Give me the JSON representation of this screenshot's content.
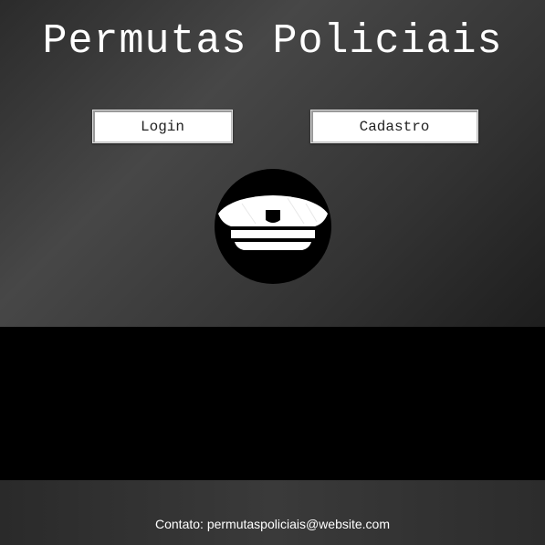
{
  "header": {
    "title": "Permutas Policiais"
  },
  "nav": {
    "login_label": "Login",
    "cadastro_label": "Cadastro"
  },
  "logo": {
    "icon": "police-cap-icon"
  },
  "footer": {
    "contact_text": "Contato: permutaspoliciais@website.com"
  },
  "colors": {
    "hero_dark": "#2b2b2b",
    "hero_light": "#474747",
    "band": "#000000",
    "text": "#ffffff",
    "button_bg": "#ffffff"
  }
}
